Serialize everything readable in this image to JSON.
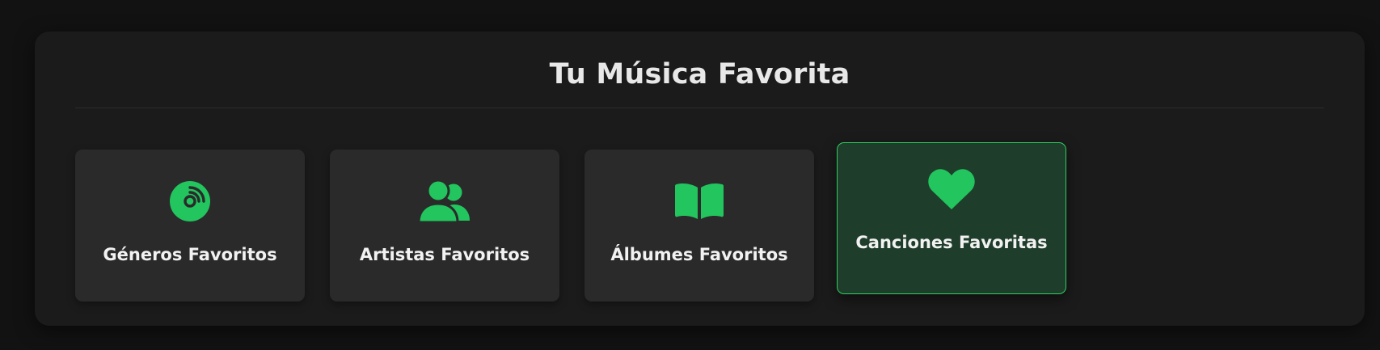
{
  "section": {
    "title": "Tu Música Favorita"
  },
  "cards": [
    {
      "label": "Géneros Favoritos",
      "icon": "disc-icon"
    },
    {
      "label": "Artistas Favoritos",
      "icon": "users-icon"
    },
    {
      "label": "Álbumes Favoritos",
      "icon": "book-open-icon"
    },
    {
      "label": "Canciones Favoritas",
      "icon": "heart-icon",
      "active": true
    }
  ],
  "colors": {
    "accent": "#22c55e",
    "background": "#121212",
    "panel": "#1b1b1b",
    "card": "#2a2a2a",
    "card_active": "#1f3d2b"
  }
}
